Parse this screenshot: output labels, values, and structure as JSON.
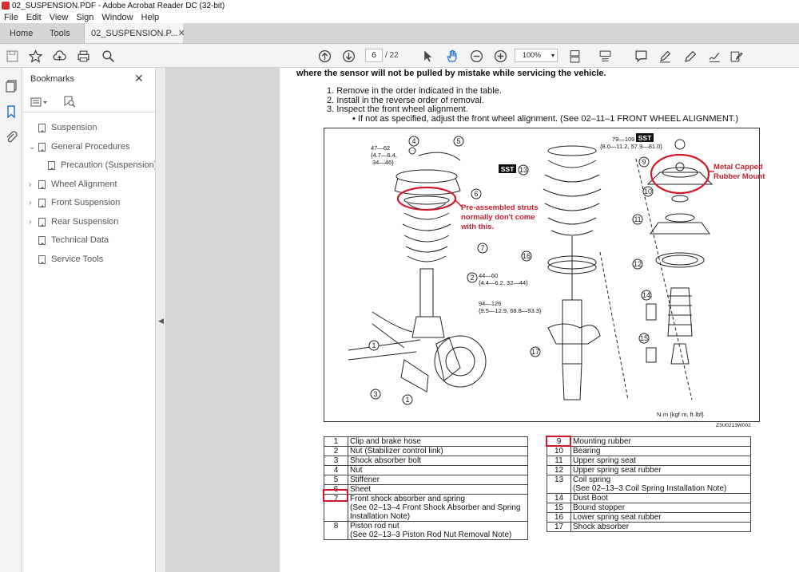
{
  "window": {
    "title": "02_SUSPENSION.PDF - Adobe Acrobat Reader DC (32-bit)"
  },
  "menu": [
    "File",
    "Edit",
    "View",
    "Sign",
    "Window",
    "Help"
  ],
  "tabs": {
    "home": "Home",
    "tools": "Tools",
    "document": "02_SUSPENSION.P..."
  },
  "toolbar": {
    "page_current": "6",
    "page_total": "/ 22",
    "zoom": "100%"
  },
  "bookmarks": {
    "header": "Bookmarks",
    "items": [
      {
        "label": "Suspension",
        "expander": ""
      },
      {
        "label": "General Procedures",
        "expander": "expanded"
      },
      {
        "label": "Precaution (Suspension)",
        "expander": ""
      },
      {
        "label": "Wheel Alignment",
        "expander": "collapsed"
      },
      {
        "label": "Front Suspension",
        "expander": "collapsed"
      },
      {
        "label": "Rear Suspension",
        "expander": "collapsed"
      },
      {
        "label": "Technical Data",
        "expander": ""
      },
      {
        "label": "Service Tools",
        "expander": ""
      }
    ]
  },
  "document": {
    "top_line": "where the sensor will not be pulled by mistake while servicing the vehicle.",
    "steps": [
      "1. Remove in the order indicated in the table.",
      "2. Install in the reverse order of removal.",
      "3. Inspect the front wheel alignment."
    ],
    "sub_step": "• If not as specified, adjust the front wheel alignment. (See 02–11–1 FRONT WHEEL ALIGNMENT.)",
    "figure": {
      "torque_top_left": [
        "47—62",
        "{4.7—6.4,",
        "34—46}"
      ],
      "torque_top_right": [
        "79—109",
        "{8.0—11.2, 57.9—81.0}"
      ],
      "torque_mid": [
        "44—60",
        "{4.4—6.2, 32—44}"
      ],
      "torque_low": [
        "94—126",
        "{9.5—12.9, 68.8—93.3}"
      ],
      "sst": "SST",
      "units": "N·m {kgf·m, ft·lbf}",
      "code": "Z3U0213W002",
      "callouts": [
        "1",
        "2",
        "3",
        "4",
        "5",
        "6",
        "7",
        "9",
        "10",
        "11",
        "12",
        "13",
        "14",
        "15",
        "16",
        "17",
        "1",
        "1"
      ]
    },
    "annotations": {
      "struts": [
        "Pre-assembled struts",
        "normally don't come",
        "with this."
      ],
      "mount": [
        "Metal Capped",
        "Rubber Mount"
      ]
    },
    "table_left": [
      {
        "n": "1",
        "t": "Clip and brake hose"
      },
      {
        "n": "2",
        "t": "Nut (Stabilizer control link)"
      },
      {
        "n": "3",
        "t": "Shock absorber bolt"
      },
      {
        "n": "4",
        "t": "Nut"
      },
      {
        "n": "5",
        "t": "Stiffener"
      },
      {
        "n": "6",
        "t": "Sheet"
      },
      {
        "n": "7",
        "t": "Front shock absorber and spring\n(See 02–13–4 Front Shock Absorber and Spring\nInstallation Note)"
      },
      {
        "n": "8",
        "t": "Piston rod nut\n(See 02–13–3 Piston Rod Nut Removal Note)"
      }
    ],
    "table_right": [
      {
        "n": "9",
        "t": "Mounting rubber"
      },
      {
        "n": "10",
        "t": "Bearing"
      },
      {
        "n": "11",
        "t": "Upper spring seat"
      },
      {
        "n": "12",
        "t": "Upper spring seat rubber"
      },
      {
        "n": "13",
        "t": "Coil spring\n(See 02–13–3 Coil Spring Installation Note)"
      },
      {
        "n": "14",
        "t": "Dust Boot"
      },
      {
        "n": "15",
        "t": "Bound stopper"
      },
      {
        "n": "16",
        "t": "Lower spring seat rubber"
      },
      {
        "n": "17",
        "t": "Shock absorber"
      }
    ]
  },
  "colors": {
    "annotation_red": "#d0192b",
    "active_blue": "#1a6fc9"
  }
}
